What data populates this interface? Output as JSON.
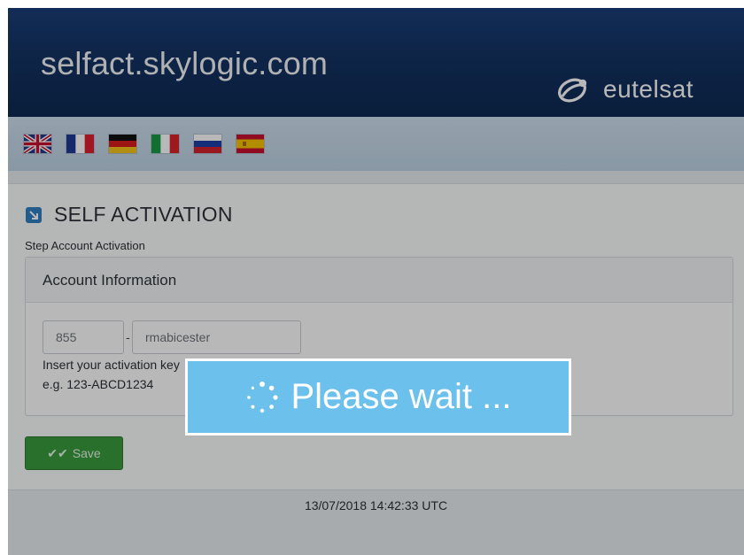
{
  "header": {
    "site_title": "selfact.skylogic.com",
    "brand_name": "eutelsat"
  },
  "languages": [
    {
      "code": "en",
      "icon": "uk-flag-icon"
    },
    {
      "code": "fr",
      "icon": "france-flag-icon"
    },
    {
      "code": "de",
      "icon": "germany-flag-icon"
    },
    {
      "code": "it",
      "icon": "italy-flag-icon"
    },
    {
      "code": "ru",
      "icon": "russia-flag-icon"
    },
    {
      "code": "es",
      "icon": "spain-flag-icon"
    }
  ],
  "main": {
    "section_title": "SELF ACTIVATION",
    "step_label": "Step Account Activation",
    "panel_title": "Account Information",
    "prefix_value": "855",
    "separator": "-",
    "key_value": "rmabicester",
    "hint_line1": "Insert your activation key",
    "hint_line2": "e.g. 123-ABCD1234",
    "save_label": "Save"
  },
  "footer": {
    "timestamp": "13/07/2018 14:42:33 UTC"
  },
  "overlay": {
    "message": "Please wait ..."
  },
  "colors": {
    "header": "#153567",
    "accent": "#2f80c3",
    "save": "#3a9b3f",
    "wait": "#6cc0ec"
  }
}
